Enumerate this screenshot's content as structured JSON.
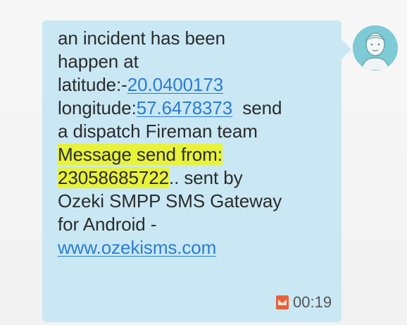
{
  "message": {
    "lines": [
      {
        "text": "an incident has been"
      },
      {
        "text": "happen at"
      },
      {
        "prefix": "latitude:-",
        "link": "20.0400173"
      },
      {
        "prefix": "longitude:",
        "link": "57.6478373",
        "suffix": "  send"
      },
      {
        "text": "a dispatch Fireman team"
      },
      {
        "highlight": "Message send from:"
      },
      {
        "highlight": "23058685722",
        "suffix": ".. sent by"
      },
      {
        "text": "Ozeki SMPP SMS Gateway"
      },
      {
        "text": "for Android -"
      },
      {
        "link": "www.ozekisms.com"
      }
    ],
    "time": "00:19",
    "status_icon": "sms-icon"
  },
  "avatar": {
    "icon": "person-avatar-icon"
  },
  "colors": {
    "bubble": "#c9e8f4",
    "link": "#2b7cd3",
    "highlight": "#e8f23a",
    "avatar_bg": "#7ecad7"
  }
}
